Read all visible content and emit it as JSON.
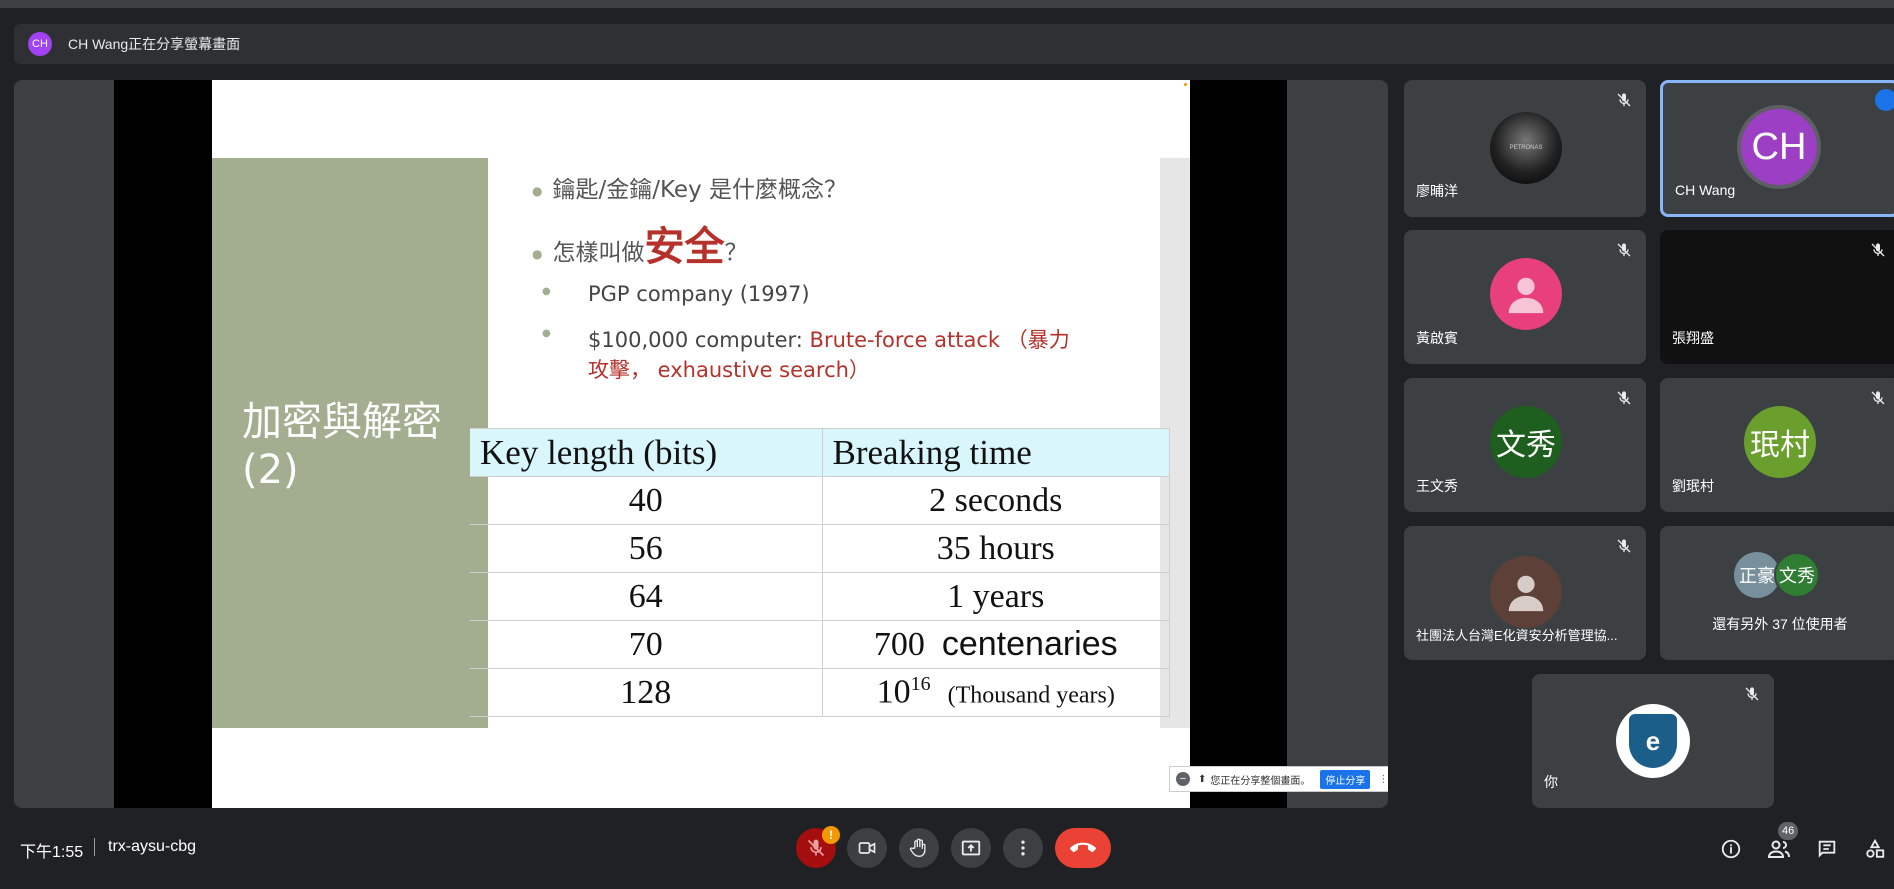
{
  "share_banner": {
    "avatar": "CH",
    "text": "CH Wang正在分享螢幕畫面"
  },
  "slide": {
    "panel_title_line1": "加密與解密",
    "panel_title_line2": "(2)",
    "bullet1": "鑰匙/金鑰/Key 是什麼概念？",
    "bullet2_pre": "怎樣叫做",
    "bullet2_emph": "安全",
    "bullet2_post": "？",
    "sub1": "PGP company (1997)",
    "sub2_black": "$100,000 computer: ",
    "sub2_red_line1": "Brute-force attack （暴力",
    "sub2_red_line2": "攻擊， exhaustive search）",
    "table": {
      "headers": [
        "Key length (bits)",
        "Breaking time"
      ],
      "rows": [
        [
          "40",
          "2 seconds"
        ],
        [
          "56",
          "35 hours"
        ],
        [
          "64",
          "1 years"
        ],
        [
          "70",
          "700",
          "centenaries"
        ],
        [
          "128",
          "10",
          "16",
          "(Thousand years)"
        ]
      ]
    }
  },
  "share_notice": {
    "text": "您正在分享整個畫面。",
    "stop_label": "停止分享"
  },
  "participants": [
    {
      "name": "廖晡洋",
      "avatar_text": "",
      "muted": true
    },
    {
      "name": "CH Wang",
      "avatar_text": "CH",
      "muted": false,
      "speaking": true
    },
    {
      "name": "黃啟賓",
      "avatar_text": "",
      "muted": true
    },
    {
      "name": "張翔盛",
      "avatar_text": "",
      "muted": true
    },
    {
      "name": "王文秀",
      "avatar_text": "文秀",
      "muted": true
    },
    {
      "name": "劉珉村",
      "avatar_text": "珉村",
      "muted": true
    },
    {
      "name": "社團法人台灣E化資安分析管理協...",
      "avatar_text": "",
      "muted": true
    },
    {
      "name": "還有另外 37 位使用者",
      "avatar_text": [
        "正豪",
        "文秀"
      ]
    },
    {
      "name": "你",
      "avatar_text": "e",
      "muted": true
    }
  ],
  "bottom_bar": {
    "time": "下午1:55",
    "meeting_code": "trx-aysu-cbg",
    "mic_warning": "!",
    "people_count": "46"
  },
  "colors": {
    "end_call": "#ea4335",
    "active_speaker_border": "#8ab4f8",
    "slide_green": "#a3ad8f"
  },
  "icons": [
    "mic-off-icon",
    "camera-icon",
    "raise-hand-icon",
    "present-icon",
    "more-options-icon",
    "end-call-icon",
    "info-icon",
    "people-icon",
    "chat-icon",
    "activities-icon"
  ]
}
